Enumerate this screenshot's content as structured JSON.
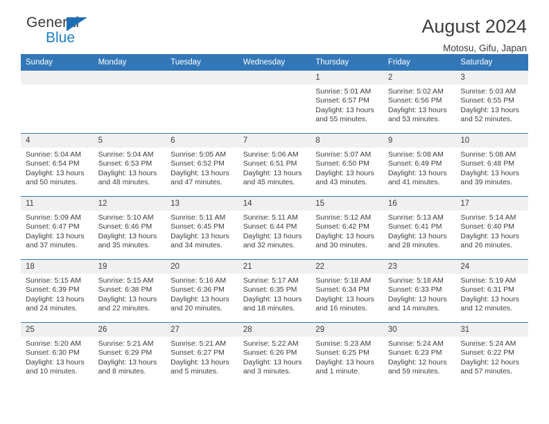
{
  "brand": {
    "name_primary": "General",
    "name_secondary": "Blue",
    "logo_icon": "blue-triangle-flag-icon"
  },
  "header": {
    "title": "August 2024",
    "subtitle": "Motosu, Gifu, Japan"
  },
  "colors": {
    "header_blue": "#3277b8",
    "brand_blue": "#1b80c4",
    "daynum_bg": "#f0f0f0",
    "text": "#3c3c3c"
  },
  "calendar": {
    "weekday_headers": [
      "Sunday",
      "Monday",
      "Tuesday",
      "Wednesday",
      "Thursday",
      "Friday",
      "Saturday"
    ],
    "weeks": [
      [
        {
          "day": "",
          "sunrise": "",
          "sunset": "",
          "daylight": ""
        },
        {
          "day": "",
          "sunrise": "",
          "sunset": "",
          "daylight": ""
        },
        {
          "day": "",
          "sunrise": "",
          "sunset": "",
          "daylight": ""
        },
        {
          "day": "",
          "sunrise": "",
          "sunset": "",
          "daylight": ""
        },
        {
          "day": "1",
          "sunrise": "Sunrise: 5:01 AM",
          "sunset": "Sunset: 6:57 PM",
          "daylight": "Daylight: 13 hours and 55 minutes."
        },
        {
          "day": "2",
          "sunrise": "Sunrise: 5:02 AM",
          "sunset": "Sunset: 6:56 PM",
          "daylight": "Daylight: 13 hours and 53 minutes."
        },
        {
          "day": "3",
          "sunrise": "Sunrise: 5:03 AM",
          "sunset": "Sunset: 6:55 PM",
          "daylight": "Daylight: 13 hours and 52 minutes."
        }
      ],
      [
        {
          "day": "4",
          "sunrise": "Sunrise: 5:04 AM",
          "sunset": "Sunset: 6:54 PM",
          "daylight": "Daylight: 13 hours and 50 minutes."
        },
        {
          "day": "5",
          "sunrise": "Sunrise: 5:04 AM",
          "sunset": "Sunset: 6:53 PM",
          "daylight": "Daylight: 13 hours and 48 minutes."
        },
        {
          "day": "6",
          "sunrise": "Sunrise: 5:05 AM",
          "sunset": "Sunset: 6:52 PM",
          "daylight": "Daylight: 13 hours and 47 minutes."
        },
        {
          "day": "7",
          "sunrise": "Sunrise: 5:06 AM",
          "sunset": "Sunset: 6:51 PM",
          "daylight": "Daylight: 13 hours and 45 minutes."
        },
        {
          "day": "8",
          "sunrise": "Sunrise: 5:07 AM",
          "sunset": "Sunset: 6:50 PM",
          "daylight": "Daylight: 13 hours and 43 minutes."
        },
        {
          "day": "9",
          "sunrise": "Sunrise: 5:08 AM",
          "sunset": "Sunset: 6:49 PM",
          "daylight": "Daylight: 13 hours and 41 minutes."
        },
        {
          "day": "10",
          "sunrise": "Sunrise: 5:08 AM",
          "sunset": "Sunset: 6:48 PM",
          "daylight": "Daylight: 13 hours and 39 minutes."
        }
      ],
      [
        {
          "day": "11",
          "sunrise": "Sunrise: 5:09 AM",
          "sunset": "Sunset: 6:47 PM",
          "daylight": "Daylight: 13 hours and 37 minutes."
        },
        {
          "day": "12",
          "sunrise": "Sunrise: 5:10 AM",
          "sunset": "Sunset: 6:46 PM",
          "daylight": "Daylight: 13 hours and 35 minutes."
        },
        {
          "day": "13",
          "sunrise": "Sunrise: 5:11 AM",
          "sunset": "Sunset: 6:45 PM",
          "daylight": "Daylight: 13 hours and 34 minutes."
        },
        {
          "day": "14",
          "sunrise": "Sunrise: 5:11 AM",
          "sunset": "Sunset: 6:44 PM",
          "daylight": "Daylight: 13 hours and 32 minutes."
        },
        {
          "day": "15",
          "sunrise": "Sunrise: 5:12 AM",
          "sunset": "Sunset: 6:42 PM",
          "daylight": "Daylight: 13 hours and 30 minutes."
        },
        {
          "day": "16",
          "sunrise": "Sunrise: 5:13 AM",
          "sunset": "Sunset: 6:41 PM",
          "daylight": "Daylight: 13 hours and 28 minutes."
        },
        {
          "day": "17",
          "sunrise": "Sunrise: 5:14 AM",
          "sunset": "Sunset: 6:40 PM",
          "daylight": "Daylight: 13 hours and 26 minutes."
        }
      ],
      [
        {
          "day": "18",
          "sunrise": "Sunrise: 5:15 AM",
          "sunset": "Sunset: 6:39 PM",
          "daylight": "Daylight: 13 hours and 24 minutes."
        },
        {
          "day": "19",
          "sunrise": "Sunrise: 5:15 AM",
          "sunset": "Sunset: 6:38 PM",
          "daylight": "Daylight: 13 hours and 22 minutes."
        },
        {
          "day": "20",
          "sunrise": "Sunrise: 5:16 AM",
          "sunset": "Sunset: 6:36 PM",
          "daylight": "Daylight: 13 hours and 20 minutes."
        },
        {
          "day": "21",
          "sunrise": "Sunrise: 5:17 AM",
          "sunset": "Sunset: 6:35 PM",
          "daylight": "Daylight: 13 hours and 18 minutes."
        },
        {
          "day": "22",
          "sunrise": "Sunrise: 5:18 AM",
          "sunset": "Sunset: 6:34 PM",
          "daylight": "Daylight: 13 hours and 16 minutes."
        },
        {
          "day": "23",
          "sunrise": "Sunrise: 5:18 AM",
          "sunset": "Sunset: 6:33 PM",
          "daylight": "Daylight: 13 hours and 14 minutes."
        },
        {
          "day": "24",
          "sunrise": "Sunrise: 5:19 AM",
          "sunset": "Sunset: 6:31 PM",
          "daylight": "Daylight: 13 hours and 12 minutes."
        }
      ],
      [
        {
          "day": "25",
          "sunrise": "Sunrise: 5:20 AM",
          "sunset": "Sunset: 6:30 PM",
          "daylight": "Daylight: 13 hours and 10 minutes."
        },
        {
          "day": "26",
          "sunrise": "Sunrise: 5:21 AM",
          "sunset": "Sunset: 6:29 PM",
          "daylight": "Daylight: 13 hours and 8 minutes."
        },
        {
          "day": "27",
          "sunrise": "Sunrise: 5:21 AM",
          "sunset": "Sunset: 6:27 PM",
          "daylight": "Daylight: 13 hours and 5 minutes."
        },
        {
          "day": "28",
          "sunrise": "Sunrise: 5:22 AM",
          "sunset": "Sunset: 6:26 PM",
          "daylight": "Daylight: 13 hours and 3 minutes."
        },
        {
          "day": "29",
          "sunrise": "Sunrise: 5:23 AM",
          "sunset": "Sunset: 6:25 PM",
          "daylight": "Daylight: 13 hours and 1 minute."
        },
        {
          "day": "30",
          "sunrise": "Sunrise: 5:24 AM",
          "sunset": "Sunset: 6:23 PM",
          "daylight": "Daylight: 12 hours and 59 minutes."
        },
        {
          "day": "31",
          "sunrise": "Sunrise: 5:24 AM",
          "sunset": "Sunset: 6:22 PM",
          "daylight": "Daylight: 12 hours and 57 minutes."
        }
      ]
    ]
  }
}
